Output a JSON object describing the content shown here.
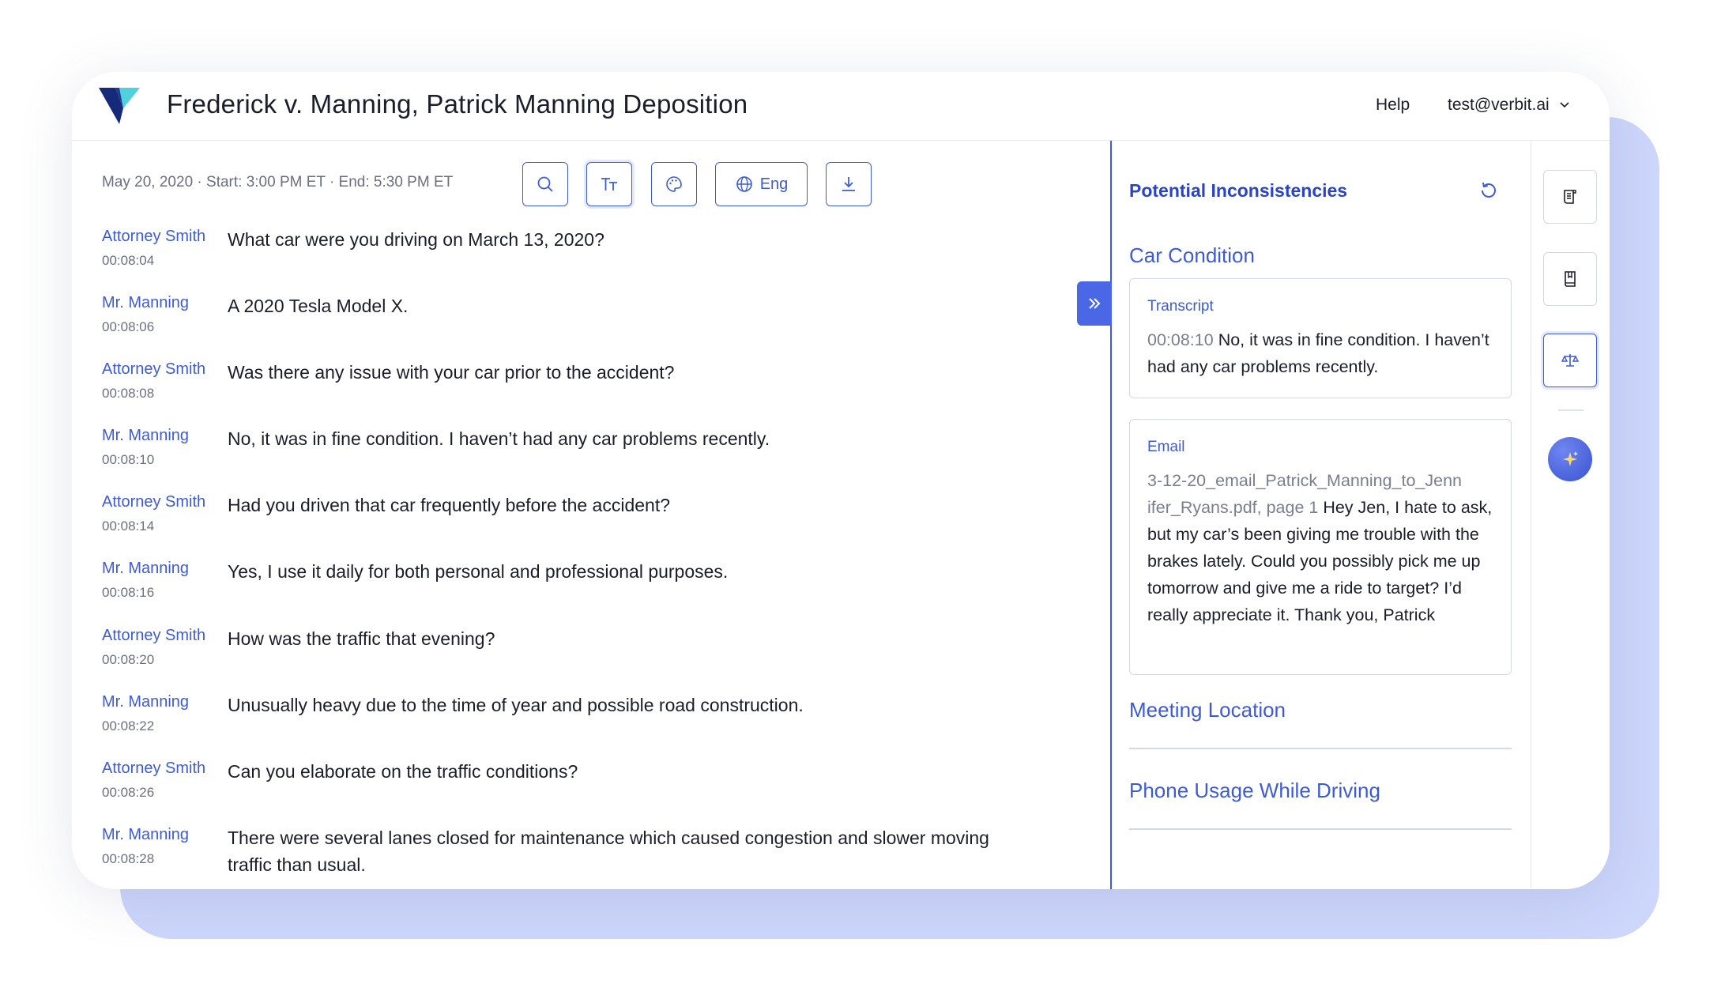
{
  "header": {
    "title": "Frederick v. Manning, Patrick Manning Deposition",
    "help": "Help",
    "user": "test@verbit.ai"
  },
  "transcript": {
    "meta": "May 20, 2020 · Start: 3:00 PM ET · End: 5:30 PM ET",
    "toolbar": {
      "search_icon": "search-icon",
      "font_size_icon": "text-size-icon",
      "theme_icon": "palette-icon",
      "language_label": "Eng",
      "download_icon": "download-icon"
    },
    "rows": [
      {
        "speaker": "Attorney Smith",
        "time": "00:08:04",
        "text": "What car were you driving on March 13, 2020?"
      },
      {
        "speaker": "Mr. Manning",
        "time": "00:08:06",
        "text": "A 2020 Tesla Model X."
      },
      {
        "speaker": "Attorney Smith",
        "time": "00:08:08",
        "text": "Was there any issue with your car prior to the accident?"
      },
      {
        "speaker": "Mr. Manning",
        "time": "00:08:10",
        "text": "No, it was in fine condition. I haven’t had any car problems recently."
      },
      {
        "speaker": "Attorney Smith",
        "time": "00:08:14",
        "text": "Had you driven that car frequently before the accident?"
      },
      {
        "speaker": "Mr. Manning",
        "time": "00:08:16",
        "text": "Yes, I use it daily for both personal and professional purposes."
      },
      {
        "speaker": "Attorney Smith",
        "time": "00:08:20",
        "text": "How was the traffic that evening?"
      },
      {
        "speaker": "Mr. Manning",
        "time": "00:08:22",
        "text": "Unusually heavy due to the time of year and possible road construction."
      },
      {
        "speaker": "Attorney Smith",
        "time": "00:08:26",
        "text": "Can you elaborate on the traffic conditions?"
      },
      {
        "speaker": "Mr. Manning",
        "time": "00:08:28",
        "text": "There were several lanes closed for maintenance which caused congestion and slower moving traffic than usual."
      }
    ]
  },
  "panel": {
    "title": "Potential Inconsistencies",
    "sections": {
      "car_condition": "Car Condition",
      "meeting_location": "Meeting Location",
      "phone_usage": "Phone Usage While Driving"
    },
    "transcript_card": {
      "label": "Transcript",
      "time": "00:08:10",
      "text": "No, it was in fine condition. I haven’t had any car problems recently."
    },
    "email_card": {
      "label": "Email",
      "source_line1": "3-12-20_email_Patrick_Manning_to_Jenn",
      "source_line2": "ifer_Ryans.pdf, page 1",
      "text": "Hey Jen, I hate to ask, but my car’s been giving me trouble with the brakes lately. Could you possibly pick me up tomorrow and give me a ride to target? I’d really appreciate it. Thank you, Patrick"
    }
  },
  "rail": {
    "icons": [
      "document-icon",
      "book-icon",
      "scales-icon",
      "sparkle-icon"
    ],
    "active": "scales-icon"
  },
  "colors": {
    "accent": "#3d5bd9",
    "accent_dark": "#2a44c7",
    "back_card": "#cdd6fb",
    "logo_cyan": "#4fd1e0",
    "logo_navy": "#152a78"
  }
}
